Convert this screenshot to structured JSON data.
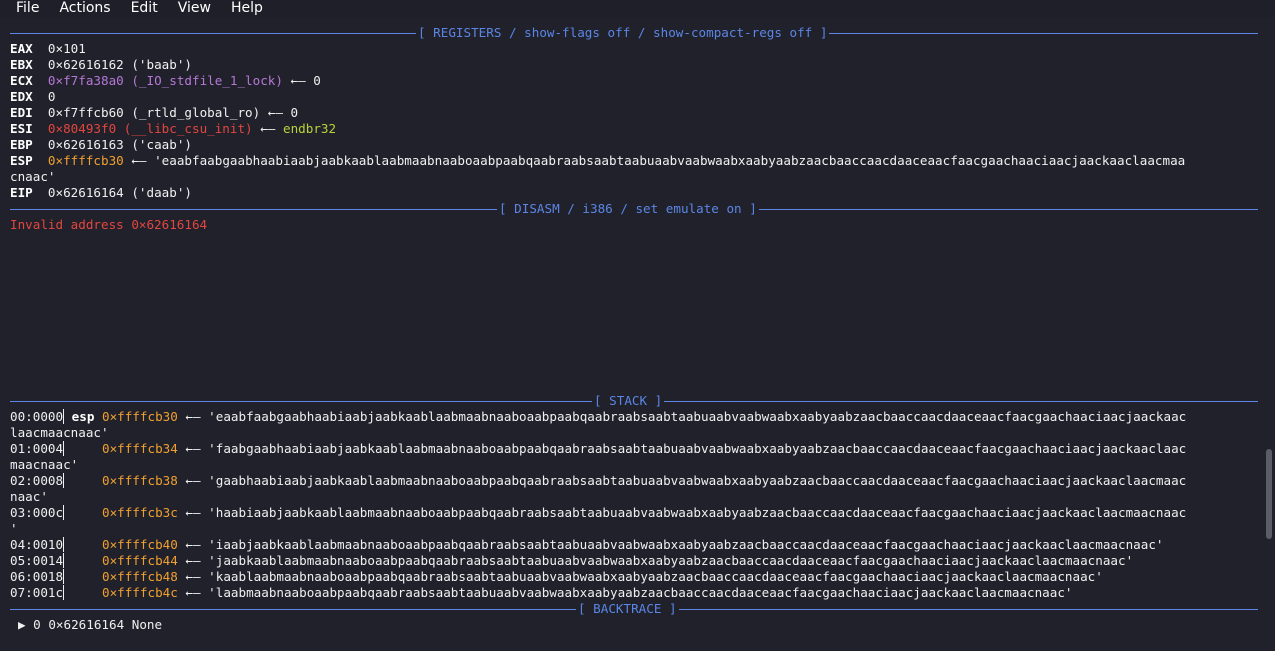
{
  "menu": {
    "file": "File",
    "actions": "Actions",
    "edit": "Edit",
    "view": "View",
    "help": "Help"
  },
  "headers": {
    "registers": "[ REGISTERS / show-flags off / show-compact-regs off ]",
    "disasm": "[ DISASM / i386 / set emulate on ]",
    "stack": "[ STACK ]",
    "backtrace": "[ BACKTRACE ]"
  },
  "registers": {
    "eax": {
      "name": "EAX",
      "value": "0×101"
    },
    "ebx": {
      "name": "EBX",
      "value": "0×62616162 ('baab')"
    },
    "ecx": {
      "name": "ECX",
      "value": "0×f7fa38a0 (_IO_stdfile_1_lock)",
      "arrow": " ←— 0"
    },
    "edx": {
      "name": "EDX",
      "value": "0"
    },
    "edi": {
      "name": "EDI",
      "value": "0×f7ffcb60 (_rtld_global_ro) ←— 0"
    },
    "esi": {
      "name": "ESI",
      "value": "0×80493f0 (__libc_csu_init)",
      "arrow": " ←— ",
      "target": "endbr32"
    },
    "ebp": {
      "name": "EBP",
      "value": "0×62616163 ('caab')"
    },
    "esp": {
      "name": "ESP",
      "addr": "0×ffffcb30",
      "value": " ←— 'eaabfaabgaabhaabiaabjaabkaablaabmaabnaaboaabpaabqaabraabsaabtaabuaabvaabwaabxaabyaabzaacbaaccaacdaaceaacfaacgaachaaciaacjaackaaclaacmaa",
      "wrap": "cnaac'"
    },
    "eip": {
      "name": "EIP",
      "value": "0×62616164 ('daab')"
    }
  },
  "disasm": {
    "error": "Invalid address 0×62616164"
  },
  "stack": [
    {
      "idx": "00:0000",
      "reg": "esp",
      "addr": "0×ffffcb30",
      "text": " ←— 'eaabfaabgaabhaabiaabjaabkaablaabmaabnaaboaabpaabqaabraabsaabtaabuaabvaabwaabxaabyaabzaacbaaccaacdaaceaacfaacgaachaaciaacjaackaac",
      "wrap": "laacmaacnaac'"
    },
    {
      "idx": "01:0004",
      "reg": "",
      "addr": "0×ffffcb34",
      "text": " ←— 'faabgaabhaabiaabjaabkaablaabmaabnaaboaabpaabqaabraabsaabtaabuaabvaabwaabxaabyaabzaacbaaccaacdaaceaacfaacgaachaaciaacjaackaaclaac",
      "wrap": "maacnaac'"
    },
    {
      "idx": "02:0008",
      "reg": "",
      "addr": "0×ffffcb38",
      "text": " ←— 'gaabhaabiaabjaabkaablaabmaabnaaboaabpaabqaabraabsaabtaabuaabvaabwaabxaabyaabzaacbaaccaacdaaceaacfaacgaachaaciaacjaackaaclaacmaac",
      "wrap": "naac'"
    },
    {
      "idx": "03:000c",
      "reg": "",
      "addr": "0×ffffcb3c",
      "text": " ←— 'haabiaabjaabkaablaabmaabnaaboaabpaabqaabraabsaabtaabuaabvaabwaabxaabyaabzaacbaaccaacdaaceaacfaacgaachaaciaacjaackaaclaacmaacnaac",
      "wrap": "'"
    },
    {
      "idx": "04:0010",
      "reg": "",
      "addr": "0×ffffcb40",
      "text": " ←— 'iaabjaabkaablaabmaabnaaboaabpaabqaabraabsaabtaabuaabvaabwaabxaabyaabzaacbaaccaacdaaceaacfaacgaachaaciaacjaackaaclaacmaacnaac'",
      "wrap": ""
    },
    {
      "idx": "05:0014",
      "reg": "",
      "addr": "0×ffffcb44",
      "text": " ←— 'jaabkaablaabmaabnaaboaabpaabqaabraabsaabtaabuaabvaabwaabxaabyaabzaacbaaccaacdaaceaacfaacgaachaaciaacjaackaaclaacmaacnaac'",
      "wrap": ""
    },
    {
      "idx": "06:0018",
      "reg": "",
      "addr": "0×ffffcb48",
      "text": " ←— 'kaablaabmaabnaaboaabpaabqaabraabsaabtaabuaabvaabwaabxaabyaabzaacbaaccaacdaaceaacfaacgaachaaciaacjaackaaclaacmaacnaac'",
      "wrap": ""
    },
    {
      "idx": "07:001c",
      "reg": "",
      "addr": "0×ffffcb4c",
      "text": " ←— 'laabmaabnaaboaabpaabqaabraabsaabtaabuaabvaabwaabxaabyaabzaacbaaccaacdaaceaacfaacgaachaaciaacjaackaaclaacmaacnaac'",
      "wrap": ""
    }
  ],
  "backtrace": {
    "line": "▶ 0 0×62616164 None"
  },
  "colors": {
    "background": "#20212b",
    "rule": "#5b86e5",
    "address": "#f0a030",
    "symbol": "#b678d6",
    "code": "#e2463f",
    "instruction": "#b6d43a"
  }
}
